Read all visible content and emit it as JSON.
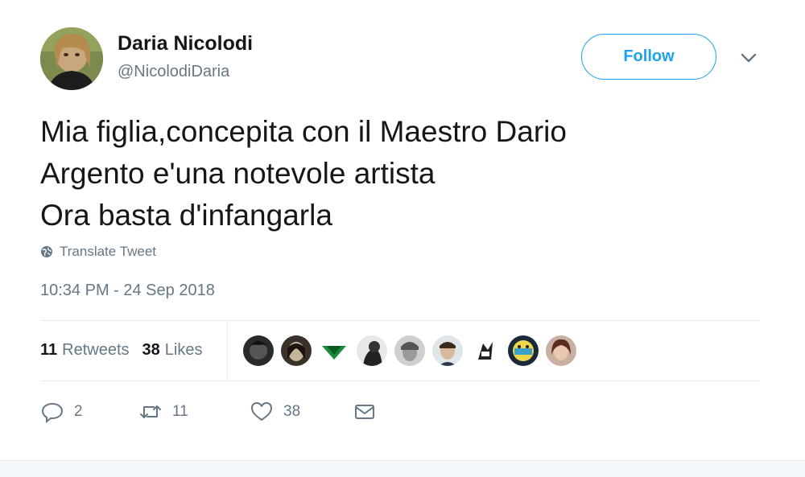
{
  "user": {
    "name": "Daria Nicolodi",
    "handle": "@NicolodiDaria"
  },
  "follow_label": "Follow",
  "tweet": {
    "text": "Mia figlia,concepita con il Maestro Dario\nArgento e'una notevole artista\nOra basta d'infangarla",
    "translate_label": "Translate Tweet",
    "timestamp": "10:34 PM - 24 Sep 2018"
  },
  "stats": {
    "retweets_count": "11",
    "retweets_label": "Retweets",
    "likes_count": "38",
    "likes_label": "Likes"
  },
  "liker_avatars": [
    {
      "icon": "avatar-1"
    },
    {
      "icon": "avatar-2"
    },
    {
      "icon": "avatar-3"
    },
    {
      "icon": "avatar-4"
    },
    {
      "icon": "avatar-5"
    },
    {
      "icon": "avatar-6"
    },
    {
      "icon": "avatar-7"
    },
    {
      "icon": "avatar-8"
    },
    {
      "icon": "avatar-9"
    }
  ],
  "actions": {
    "replies": "2",
    "retweets": "11",
    "likes": "38"
  },
  "colors": {
    "accent": "#1da1f2",
    "muted": "#657786",
    "text": "#14171a"
  }
}
